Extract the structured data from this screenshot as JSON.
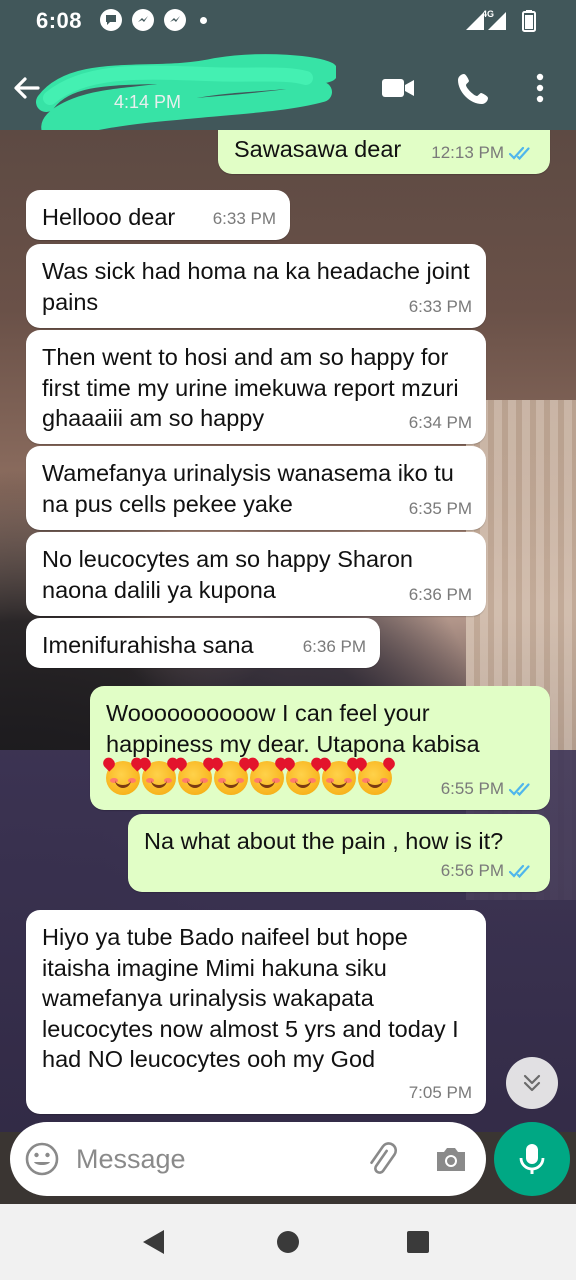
{
  "status_bar": {
    "time": "6:08",
    "network_label": "4G",
    "notification_icons": [
      "chat-bubble-icon",
      "messenger-icon",
      "messenger-icon"
    ]
  },
  "header": {
    "contact_name_redacted": true,
    "last_seen": "4:14 PM",
    "icons": [
      "back-arrow-icon",
      "video-call-icon",
      "phone-icon",
      "more-vert-icon"
    ]
  },
  "messages": [
    {
      "dir": "out",
      "text": "Sawasawa dear",
      "time": "12:13 PM",
      "read": true
    },
    {
      "dir": "in",
      "text": "Hellooo dear",
      "time": "6:33 PM"
    },
    {
      "dir": "in",
      "text": "Was sick had homa na ka headache joint pains",
      "time": "6:33 PM"
    },
    {
      "dir": "in",
      "text": "Then went to hosi and am so happy for first time my urine imekuwa report mzuri ghaaaiii am so happy",
      "time": "6:34 PM"
    },
    {
      "dir": "in",
      "text": "Wamefanya urinalysis wanasema iko tu na pus cells pekee yake",
      "time": "6:35 PM"
    },
    {
      "dir": "in",
      "text": "No leucocytes am so happy Sharon naona dalili ya kupona",
      "time": "6:36 PM"
    },
    {
      "dir": "in",
      "text": "Imenifurahisha sana",
      "time": "6:36 PM"
    },
    {
      "dir": "out",
      "text": "Woooooooooow I can feel your happiness my dear. Utapona kabisa",
      "emoji_count": 8,
      "emoji": "smiling-face-with-hearts",
      "time": "6:55 PM",
      "read": true
    },
    {
      "dir": "out",
      "text": "Na what about the pain , how is it?",
      "time": "6:56 PM",
      "read": true
    },
    {
      "dir": "in",
      "text": "Hiyo ya tube Bado naifeel but hope itaisha imagine Mimi hakuna siku wamefanya urinalysis wakapata leucocytes now almost 5 yrs and today I had NO leucocytes ooh my God",
      "time": "7:05 PM"
    }
  ],
  "composer": {
    "placeholder": "Message"
  },
  "colors": {
    "app_bar": "#41575a",
    "incoming_bubble": "#ffffff",
    "outgoing_bubble": "#e1fec6",
    "read_ticks": "#4fb6ec",
    "mic_button": "#00a884"
  }
}
